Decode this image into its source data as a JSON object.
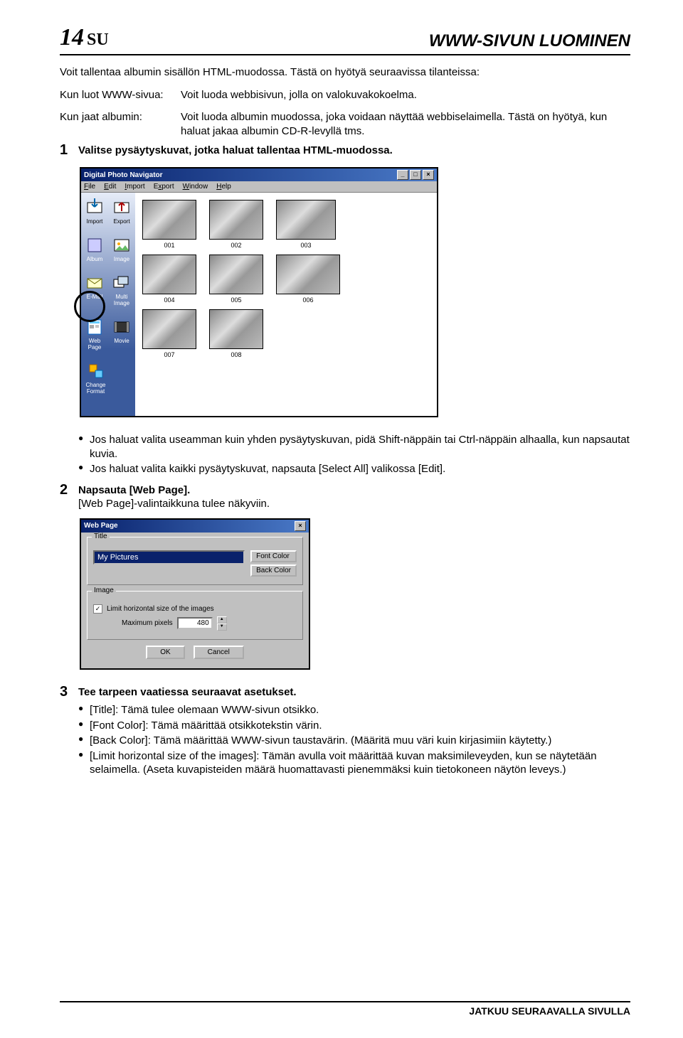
{
  "header": {
    "page_number": "14",
    "page_suffix": "SU",
    "section_title": "WWW-SIVUN LUOMINEN"
  },
  "intro": "Voit tallentaa albumin sisällön HTML-muodossa. Tästä on hyötyä seuraavissa tilanteissa:",
  "defs": [
    {
      "term": "Kun luot WWW-sivua:",
      "body": "Voit luoda webbisivun, jolla on valokuvakokoelma."
    },
    {
      "term": "Kun jaat albumin:",
      "body": "Voit luoda albumin muodossa, joka voidaan näyttää webbiselaimella. Tästä on hyötyä, kun haluat jakaa albumin CD-R-levyllä tms."
    }
  ],
  "steps": {
    "step1": {
      "num": "1",
      "title": "Valitse pysäytyskuvat, jotka haluat tallentaa HTML-muodossa.",
      "bullets": [
        "Jos haluat valita useamman kuin yhden pysäytyskuvan, pidä Shift-näppäin tai Ctrl-näppäin alhaalla, kun napsautat kuvia.",
        "Jos haluat valita kaikki pysäytyskuvat, napsauta [Select All] valikossa [Edit]."
      ]
    },
    "step2": {
      "num": "2",
      "title": "Napsauta [Web Page].",
      "text": "[Web Page]-valintaikkuna tulee näkyviin."
    },
    "step3": {
      "num": "3",
      "title": "Tee tarpeen vaatiessa seuraavat asetukset.",
      "bullets": [
        "[Title]: Tämä tulee olemaan WWW-sivun otsikko.",
        "[Font Color]: Tämä määrittää otsikkotekstin värin.",
        "[Back Color]: Tämä määrittää WWW-sivun taustavärin. (Määritä muu väri kuin kirjasimiin käytetty.)",
        "[Limit horizontal size of the images]: Tämän avulla voit määrittää kuvan maksimileveyden, kun se näytetään selaimella. (Aseta kuvapisteiden määrä huomattavasti pienemmäksi kuin tietokoneen näytön leveys.)"
      ]
    }
  },
  "dpn_window": {
    "title": "Digital Photo Navigator",
    "menu": [
      "File",
      "Edit",
      "Import",
      "Export",
      "Window",
      "Help"
    ],
    "sidebar": {
      "row1": [
        "Import",
        "Export"
      ],
      "row2": [
        "Album",
        "Image"
      ],
      "row3": [
        "E-Mail",
        "Multi Image"
      ],
      "row4": [
        "Web Page",
        "Movie"
      ],
      "row5": [
        "Change Format"
      ]
    },
    "thumbs": [
      "001",
      "002",
      "003",
      "004",
      "005",
      "006",
      "007",
      "008"
    ]
  },
  "wp_dialog": {
    "title": "Web Page",
    "group_title": "Title",
    "title_value": "My Pictures",
    "font_btn": "Font Color",
    "back_btn": "Back Color",
    "group_image": "Image",
    "limit_label": "Limit horizontal size of the images",
    "max_label": "Maximum pixels",
    "max_value": "480",
    "ok": "OK",
    "cancel": "Cancel"
  },
  "footer": "JATKUU SEURAAVALLA SIVULLA"
}
